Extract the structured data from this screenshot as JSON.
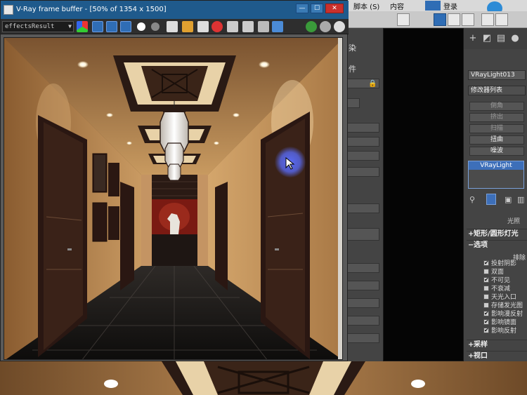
{
  "vray_window": {
    "title": "V-Ray frame buffer - [50% of 1354 x 1500]",
    "channel": "effectsResult",
    "minimize": "—",
    "maximize": "☐",
    "close": "✕"
  },
  "max_menu": {
    "items": [
      "脚本 (S)",
      "内容",
      "登录"
    ]
  },
  "command_panel": {
    "object_name": "VRayLight013",
    "modifier_list": "修改器列表",
    "modifier_buttons": [
      "倒角",
      "挤出",
      "扫描",
      "扭曲",
      "噪波"
    ],
    "stack_item": "VRayLight",
    "right_label": "光照",
    "rollout_rect": "矩形/圆形灯光",
    "rollout_options": "选项",
    "options_top_label": "排除",
    "options": [
      {
        "label": "投射阴影",
        "checked": true
      },
      {
        "label": "双面",
        "checked": false
      },
      {
        "label": "不可见",
        "checked": true
      },
      {
        "label": "不衰减",
        "checked": false
      },
      {
        "label": "天光入口",
        "checked": false
      },
      {
        "label": "存储发光图",
        "checked": false
      },
      {
        "label": "影响漫反射",
        "checked": true
      },
      {
        "label": "影响镜面",
        "checked": true
      },
      {
        "label": "影响反射",
        "checked": true
      }
    ],
    "rollout_sampling": "采样",
    "rollout_viewport": "视口"
  },
  "mid_panel": {
    "label1": "染",
    "label2": "件"
  },
  "colors": {
    "titlebar": "#1f5a8c",
    "highlight": "#3d6fb9",
    "wall": "#b8864f",
    "door": "#2a1712"
  }
}
